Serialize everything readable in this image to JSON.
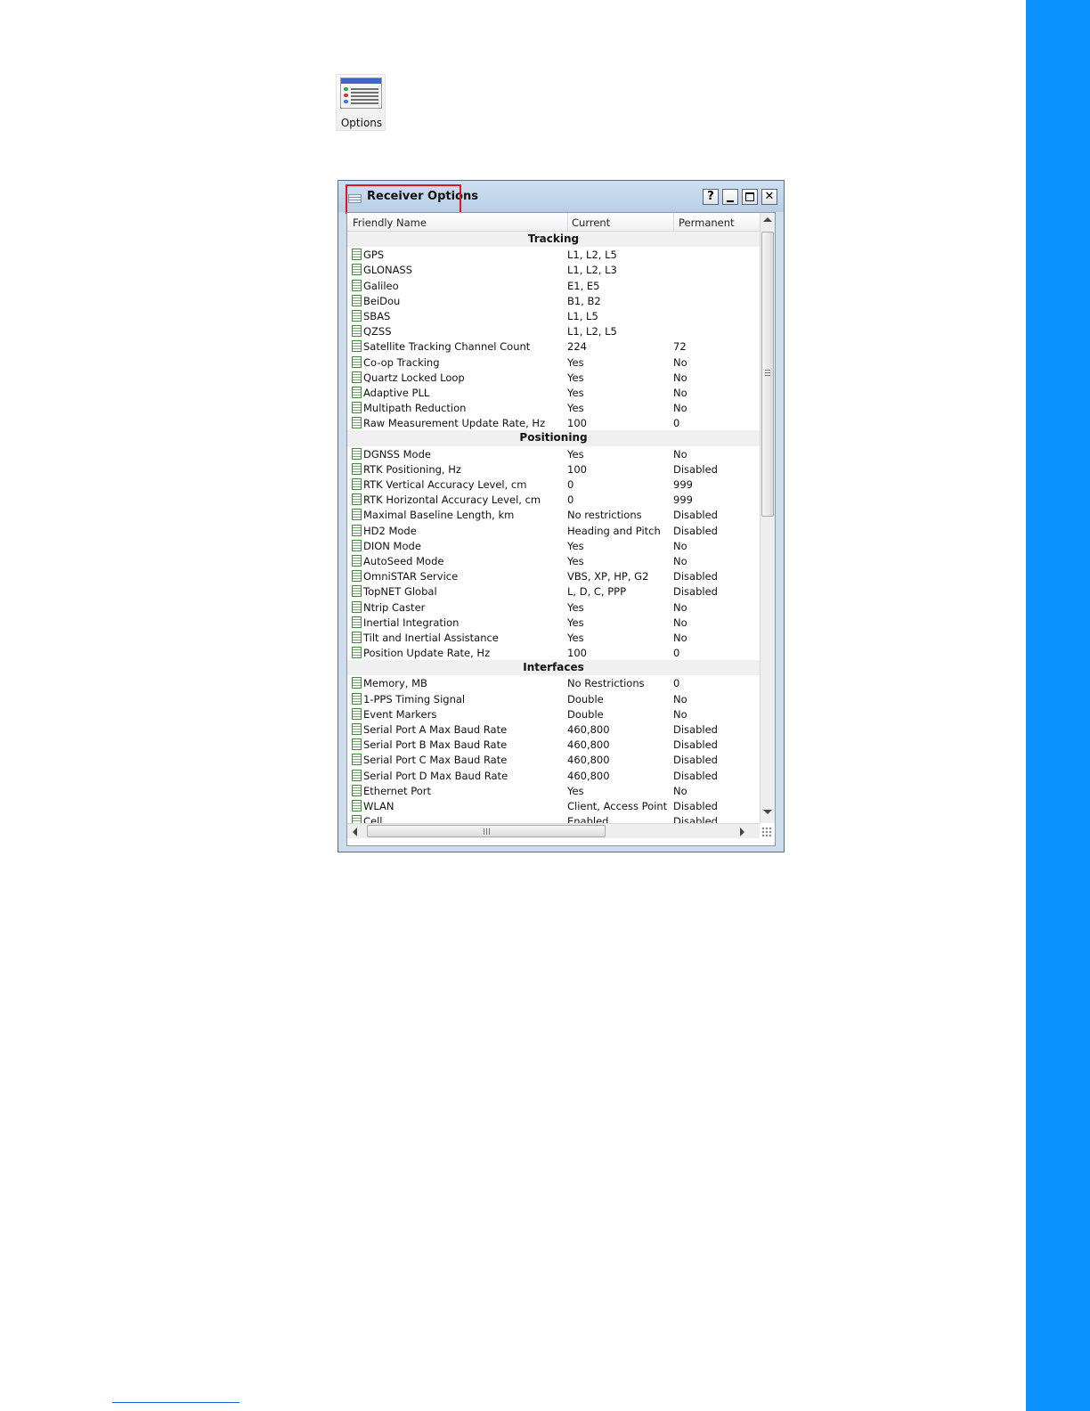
{
  "launcher": {
    "icon": "options-table-icon",
    "label": "Options"
  },
  "window": {
    "title": "Receiver Options",
    "icons": {
      "title": "window-list-icon"
    },
    "buttons": {
      "help": "?",
      "minimize": "minimize-icon",
      "maximize": "maximize-icon",
      "close": "✕"
    }
  },
  "grid": {
    "columns": [
      "Friendly Name",
      "Current",
      "Permanent"
    ],
    "sections": [
      {
        "title": "Tracking",
        "rows": [
          {
            "name": "GPS",
            "current": "L1, L2, L5",
            "permanent": ""
          },
          {
            "name": "GLONASS",
            "current": "L1, L2, L3",
            "permanent": ""
          },
          {
            "name": "Galileo",
            "current": "E1, E5",
            "permanent": ""
          },
          {
            "name": "BeiDou",
            "current": "B1, B2",
            "permanent": ""
          },
          {
            "name": "SBAS",
            "current": "L1, L5",
            "permanent": ""
          },
          {
            "name": "QZSS",
            "current": "L1, L2, L5",
            "permanent": ""
          },
          {
            "name": "Satellite Tracking Channel Count",
            "current": "224",
            "permanent": "72"
          },
          {
            "name": "Co-op Tracking",
            "current": "Yes",
            "permanent": "No"
          },
          {
            "name": "Quartz Locked Loop",
            "current": "Yes",
            "permanent": "No"
          },
          {
            "name": "Adaptive PLL",
            "current": "Yes",
            "permanent": "No"
          },
          {
            "name": "Multipath Reduction",
            "current": "Yes",
            "permanent": "No"
          },
          {
            "name": "Raw Measurement Update Rate, Hz",
            "current": "100",
            "permanent": "0"
          }
        ]
      },
      {
        "title": "Positioning",
        "rows": [
          {
            "name": "DGNSS Mode",
            "current": "Yes",
            "permanent": "No"
          },
          {
            "name": "RTK Positioning, Hz",
            "current": "100",
            "permanent": "Disabled"
          },
          {
            "name": "RTK Vertical Accuracy Level, cm",
            "current": "0",
            "permanent": "999"
          },
          {
            "name": "RTK Horizontal Accuracy Level, cm",
            "current": "0",
            "permanent": "999"
          },
          {
            "name": "Maximal Baseline Length, km",
            "current": "No restrictions",
            "permanent": "Disabled"
          },
          {
            "name": "HD2 Mode",
            "current": "Heading and Pitch",
            "permanent": "Disabled"
          },
          {
            "name": "DION Mode",
            "current": "Yes",
            "permanent": "No"
          },
          {
            "name": "AutoSeed Mode",
            "current": "Yes",
            "permanent": "No"
          },
          {
            "name": "OmniSTAR Service",
            "current": "VBS, XP, HP, G2",
            "permanent": "Disabled"
          },
          {
            "name": "TopNET Global",
            "current": "L, D, C, PPP",
            "permanent": "Disabled"
          },
          {
            "name": "Ntrip Caster",
            "current": "Yes",
            "permanent": "No"
          },
          {
            "name": "Inertial Integration",
            "current": "Yes",
            "permanent": "No"
          },
          {
            "name": "Tilt and Inertial Assistance",
            "current": "Yes",
            "permanent": "No"
          },
          {
            "name": "Position Update Rate, Hz",
            "current": "100",
            "permanent": "0"
          }
        ]
      },
      {
        "title": "Interfaces",
        "rows": [
          {
            "name": "Memory, MB",
            "current": "No Restrictions",
            "permanent": "0"
          },
          {
            "name": "1-PPS Timing Signal",
            "current": "Double",
            "permanent": "No"
          },
          {
            "name": "Event Markers",
            "current": "Double",
            "permanent": "No"
          },
          {
            "name": "Serial Port A Max Baud Rate",
            "current": "460,800",
            "permanent": "Disabled"
          },
          {
            "name": "Serial Port B Max Baud Rate",
            "current": "460,800",
            "permanent": "Disabled"
          },
          {
            "name": "Serial Port C Max Baud Rate",
            "current": "460,800",
            "permanent": "Disabled"
          },
          {
            "name": "Serial Port D Max Baud Rate",
            "current": "460,800",
            "permanent": "Disabled"
          },
          {
            "name": "Ethernet Port",
            "current": "Yes",
            "permanent": "No"
          },
          {
            "name": "WLAN",
            "current": "Client, Access Point",
            "permanent": "Disabled"
          },
          {
            "name": "Cell",
            "current": "Enabled",
            "permanent": "Disabled"
          }
        ]
      }
    ]
  },
  "colors": {
    "accent_bar": "#0a93ff",
    "highlight_box": "#e0141c"
  }
}
